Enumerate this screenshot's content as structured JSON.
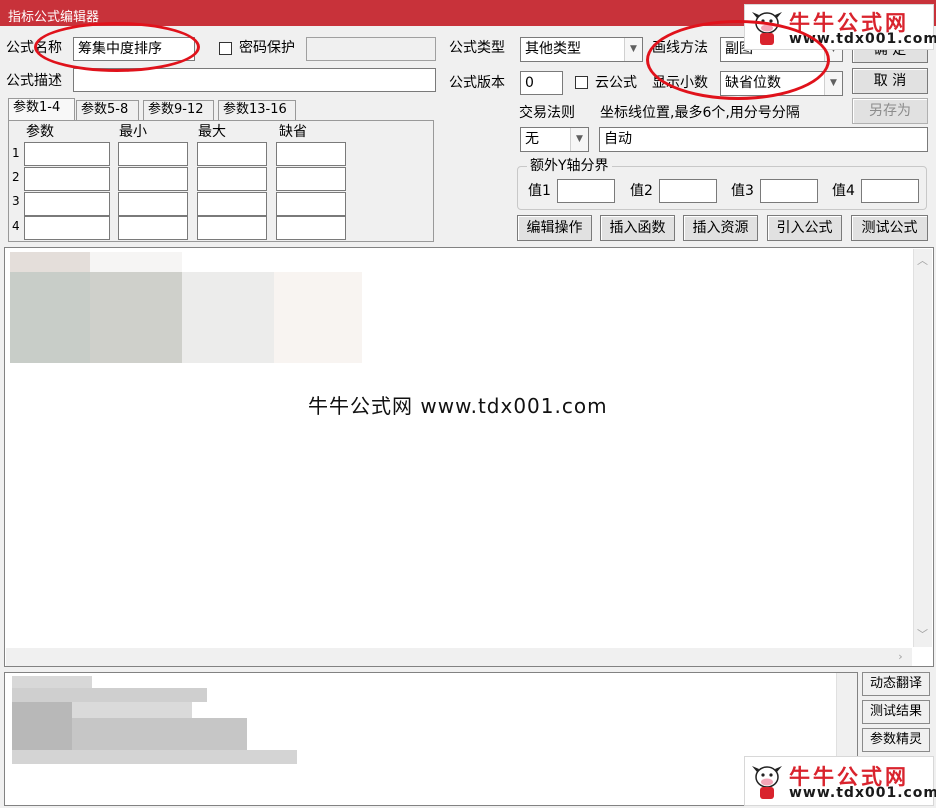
{
  "window": {
    "title": "指标公式编辑器"
  },
  "form": {
    "name_label": "公式名称",
    "name_value": "筹集中度排序",
    "password_label": "密码保护",
    "desc_label": "公式描述",
    "type_label": "公式类型",
    "type_value": "其他类型",
    "version_label": "公式版本",
    "version_value": "0",
    "cloud_label": "云公式",
    "draw_label": "画线方法",
    "draw_value": "副图",
    "decimals_label": "显示小数",
    "decimals_value": "缺省位数",
    "trade_rule_label": "交易法则",
    "trade_rule_value": "无",
    "axis_hint_label": "坐标线位置,最多6个,用分号分隔",
    "axis_value": "自动",
    "yaxis_group_label": "额外Y轴分界",
    "val1_label": "值1",
    "val2_label": "值2",
    "val3_label": "值3",
    "val4_label": "值4"
  },
  "buttons": {
    "ok": "确 定",
    "cancel": "取 消",
    "save_as": "另存为",
    "edit_ops": "编辑操作",
    "insert_func": "插入函数",
    "insert_res": "插入资源",
    "import_formula": "引入公式",
    "test_formula": "测试公式",
    "dynamic_translate": "动态翻译",
    "test_result": "测试结果",
    "param_wizard": "参数精灵"
  },
  "param_tabs": [
    "参数1-4",
    "参数5-8",
    "参数9-12",
    "参数13-16"
  ],
  "param_table": {
    "headers": [
      "参数",
      "最小",
      "最大",
      "缺省"
    ],
    "rows": [
      "1",
      "2",
      "3",
      "4"
    ]
  },
  "watermark": {
    "center": "牛牛公式网 www.tdx001.com",
    "logo_cn": "牛牛公式网",
    "logo_url": "www.tdx001.com"
  },
  "colors": {
    "title_bar": "#c8323a",
    "highlight_oval": "#e0121b",
    "logo_red": "#d9232d"
  }
}
